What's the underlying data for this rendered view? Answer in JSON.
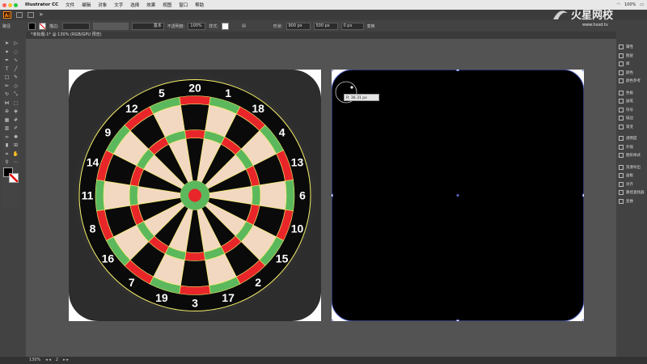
{
  "menubar": {
    "app_name": "Illustrator CC",
    "items": [
      "文件",
      "编辑",
      "对象",
      "文字",
      "选择",
      "效果",
      "视图",
      "窗口",
      "帮助"
    ],
    "status_right": "100%"
  },
  "control_bar": {
    "path_label": "路径",
    "stroke_label": "描边:",
    "uniform_label": "基本",
    "opacity_label": "不透明度:",
    "opacity_value": "100%",
    "style_label": "样式:",
    "shape_label": "形状:",
    "width_value": "900 px",
    "height_value": "500 px",
    "corner_value": "0 px",
    "transform_label": "变换"
  },
  "document": {
    "tab_title": "*未标题-1* @ 130% (RGB/GPU 预览)",
    "zoom": "130%",
    "page_value": "2"
  },
  "tooltip": "R: 36.31 px",
  "dartboard": {
    "numbers": [
      "20",
      "1",
      "18",
      "4",
      "13",
      "6",
      "10",
      "15",
      "2",
      "17",
      "3",
      "19",
      "7",
      "16",
      "8",
      "11",
      "14",
      "9",
      "12",
      "5"
    ]
  },
  "right_panel": {
    "items": [
      "属性",
      "图层",
      "库",
      "颜色",
      "颜色参考",
      "色板",
      "画笔",
      "符号",
      "描边",
      "渐变",
      "透明度",
      "外观",
      "图形样式",
      "资源导出",
      "画板",
      "对齐",
      "路径查找器",
      "变换"
    ]
  },
  "watermark": {
    "brand": "火星网校",
    "url": "www.hxsd.tv"
  },
  "colors": {
    "board_red": "#e8262a",
    "board_green": "#5cb85c",
    "board_cream": "#f2d8c0",
    "board_black": "#0a0a0a",
    "wire_yellow": "#f5ef6a",
    "tile_bg": "#2d2d2d",
    "selection_blue": "#5b6dd6"
  }
}
